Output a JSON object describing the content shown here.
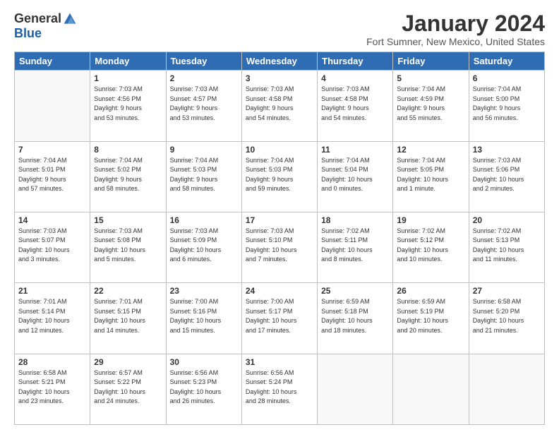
{
  "logo": {
    "general": "General",
    "blue": "Blue"
  },
  "title": "January 2024",
  "location": "Fort Sumner, New Mexico, United States",
  "days_header": [
    "Sunday",
    "Monday",
    "Tuesday",
    "Wednesday",
    "Thursday",
    "Friday",
    "Saturday"
  ],
  "weeks": [
    [
      {
        "num": "",
        "empty": true
      },
      {
        "num": "1",
        "sunrise": "7:03 AM",
        "sunset": "4:56 PM",
        "daylight": "9 hours and 53 minutes."
      },
      {
        "num": "2",
        "sunrise": "7:03 AM",
        "sunset": "4:57 PM",
        "daylight": "9 hours and 53 minutes."
      },
      {
        "num": "3",
        "sunrise": "7:03 AM",
        "sunset": "4:58 PM",
        "daylight": "9 hours and 54 minutes."
      },
      {
        "num": "4",
        "sunrise": "7:03 AM",
        "sunset": "4:58 PM",
        "daylight": "9 hours and 54 minutes."
      },
      {
        "num": "5",
        "sunrise": "7:04 AM",
        "sunset": "4:59 PM",
        "daylight": "9 hours and 55 minutes."
      },
      {
        "num": "6",
        "sunrise": "7:04 AM",
        "sunset": "5:00 PM",
        "daylight": "9 hours and 56 minutes."
      }
    ],
    [
      {
        "num": "7",
        "sunrise": "7:04 AM",
        "sunset": "5:01 PM",
        "daylight": "9 hours and 57 minutes."
      },
      {
        "num": "8",
        "sunrise": "7:04 AM",
        "sunset": "5:02 PM",
        "daylight": "9 hours and 58 minutes."
      },
      {
        "num": "9",
        "sunrise": "7:04 AM",
        "sunset": "5:03 PM",
        "daylight": "9 hours and 58 minutes."
      },
      {
        "num": "10",
        "sunrise": "7:04 AM",
        "sunset": "5:03 PM",
        "daylight": "9 hours and 59 minutes."
      },
      {
        "num": "11",
        "sunrise": "7:04 AM",
        "sunset": "5:04 PM",
        "daylight": "10 hours and 0 minutes."
      },
      {
        "num": "12",
        "sunrise": "7:04 AM",
        "sunset": "5:05 PM",
        "daylight": "10 hours and 1 minute."
      },
      {
        "num": "13",
        "sunrise": "7:03 AM",
        "sunset": "5:06 PM",
        "daylight": "10 hours and 2 minutes."
      }
    ],
    [
      {
        "num": "14",
        "sunrise": "7:03 AM",
        "sunset": "5:07 PM",
        "daylight": "10 hours and 3 minutes."
      },
      {
        "num": "15",
        "sunrise": "7:03 AM",
        "sunset": "5:08 PM",
        "daylight": "10 hours and 5 minutes."
      },
      {
        "num": "16",
        "sunrise": "7:03 AM",
        "sunset": "5:09 PM",
        "daylight": "10 hours and 6 minutes."
      },
      {
        "num": "17",
        "sunrise": "7:03 AM",
        "sunset": "5:10 PM",
        "daylight": "10 hours and 7 minutes."
      },
      {
        "num": "18",
        "sunrise": "7:02 AM",
        "sunset": "5:11 PM",
        "daylight": "10 hours and 8 minutes."
      },
      {
        "num": "19",
        "sunrise": "7:02 AM",
        "sunset": "5:12 PM",
        "daylight": "10 hours and 10 minutes."
      },
      {
        "num": "20",
        "sunrise": "7:02 AM",
        "sunset": "5:13 PM",
        "daylight": "10 hours and 11 minutes."
      }
    ],
    [
      {
        "num": "21",
        "sunrise": "7:01 AM",
        "sunset": "5:14 PM",
        "daylight": "10 hours and 12 minutes."
      },
      {
        "num": "22",
        "sunrise": "7:01 AM",
        "sunset": "5:15 PM",
        "daylight": "10 hours and 14 minutes."
      },
      {
        "num": "23",
        "sunrise": "7:00 AM",
        "sunset": "5:16 PM",
        "daylight": "10 hours and 15 minutes."
      },
      {
        "num": "24",
        "sunrise": "7:00 AM",
        "sunset": "5:17 PM",
        "daylight": "10 hours and 17 minutes."
      },
      {
        "num": "25",
        "sunrise": "6:59 AM",
        "sunset": "5:18 PM",
        "daylight": "10 hours and 18 minutes."
      },
      {
        "num": "26",
        "sunrise": "6:59 AM",
        "sunset": "5:19 PM",
        "daylight": "10 hours and 20 minutes."
      },
      {
        "num": "27",
        "sunrise": "6:58 AM",
        "sunset": "5:20 PM",
        "daylight": "10 hours and 21 minutes."
      }
    ],
    [
      {
        "num": "28",
        "sunrise": "6:58 AM",
        "sunset": "5:21 PM",
        "daylight": "10 hours and 23 minutes."
      },
      {
        "num": "29",
        "sunrise": "6:57 AM",
        "sunset": "5:22 PM",
        "daylight": "10 hours and 24 minutes."
      },
      {
        "num": "30",
        "sunrise": "6:56 AM",
        "sunset": "5:23 PM",
        "daylight": "10 hours and 26 minutes."
      },
      {
        "num": "31",
        "sunrise": "6:56 AM",
        "sunset": "5:24 PM",
        "daylight": "10 hours and 28 minutes."
      },
      {
        "num": "",
        "empty": true
      },
      {
        "num": "",
        "empty": true
      },
      {
        "num": "",
        "empty": true
      }
    ]
  ],
  "labels": {
    "sunrise": "Sunrise:",
    "sunset": "Sunset:",
    "daylight": "Daylight:"
  }
}
